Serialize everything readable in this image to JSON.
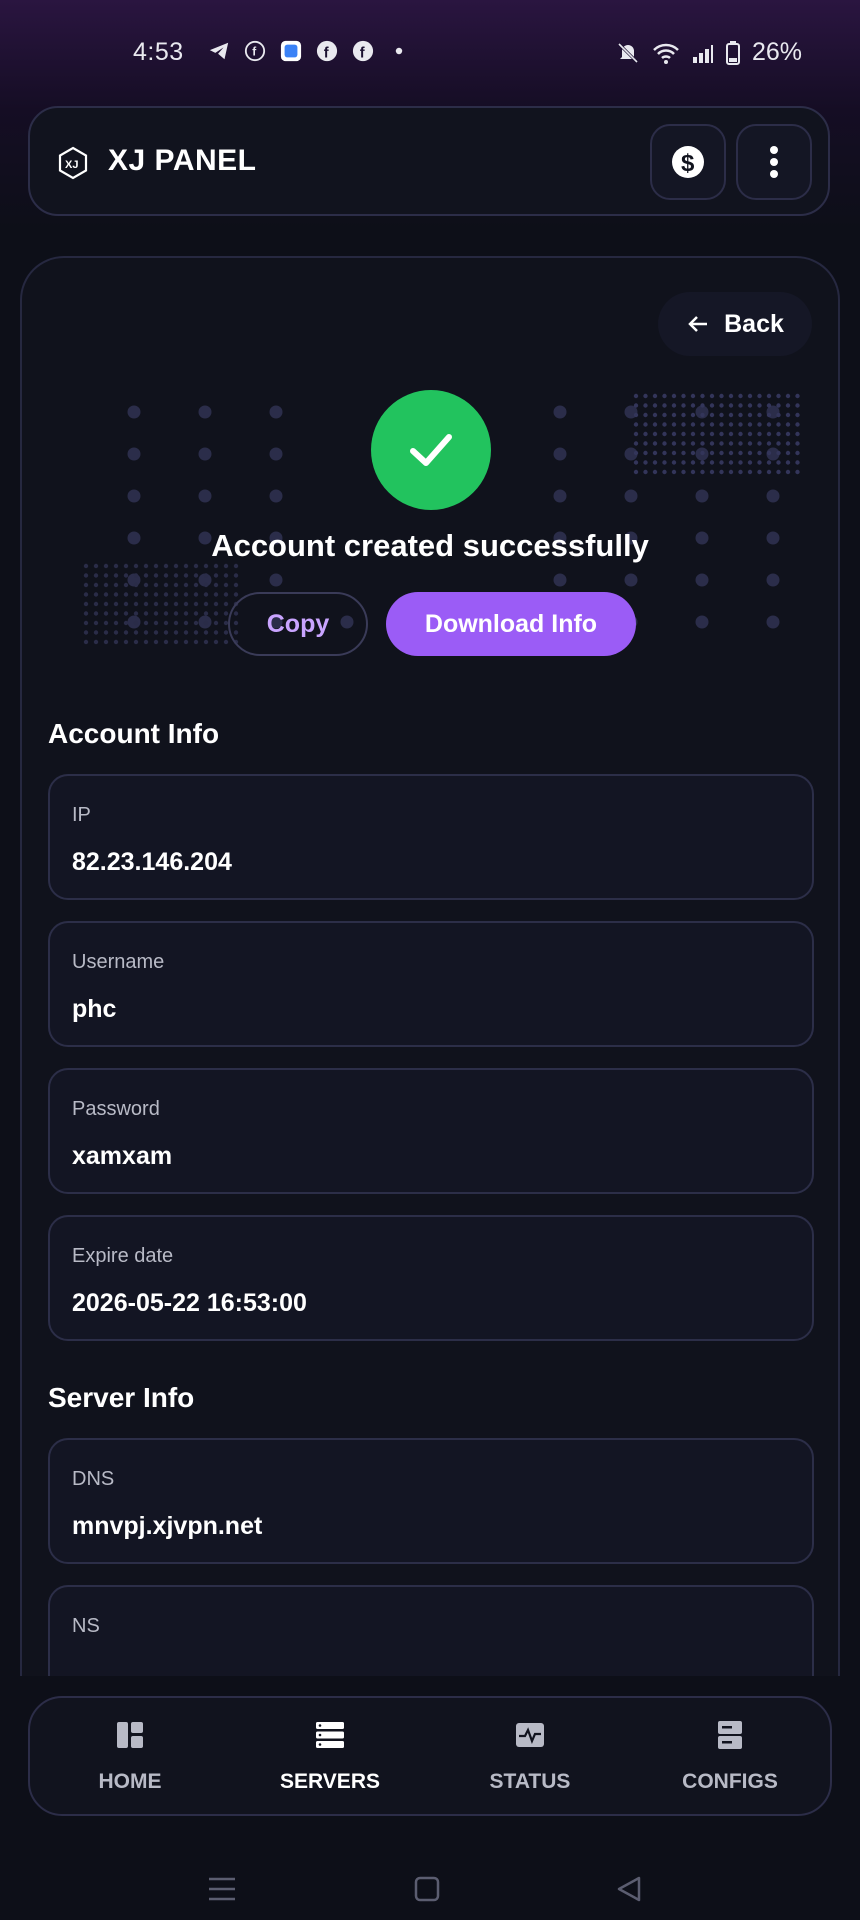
{
  "status_bar": {
    "time": "4:53",
    "battery": "26%"
  },
  "header": {
    "title": "XJ PANEL"
  },
  "card": {
    "back_label": "Back",
    "success_message": "Account created successfully",
    "copy_label": "Copy",
    "download_label": "Download Info"
  },
  "account_info": {
    "title": "Account Info",
    "fields": [
      {
        "label": "IP",
        "value": "82.23.146.204"
      },
      {
        "label": "Username",
        "value": "phc"
      },
      {
        "label": "Password",
        "value": "xamxam"
      },
      {
        "label": "Expire date",
        "value": "2026-05-22 16:53:00"
      }
    ]
  },
  "server_info": {
    "title": "Server Info",
    "fields": [
      {
        "label": "DNS",
        "value": "mnvpj.xjvpn.net"
      },
      {
        "label": "NS",
        "value": ""
      }
    ]
  },
  "nav": {
    "items": [
      {
        "label": "HOME",
        "icon": "layout-icon"
      },
      {
        "label": "SERVERS",
        "icon": "server-list-icon"
      },
      {
        "label": "STATUS",
        "icon": "pulse-icon"
      },
      {
        "label": "CONFIGS",
        "icon": "config-icon"
      }
    ],
    "active": "SERVERS"
  },
  "colors": {
    "accent": "#9b5cf6",
    "success": "#22c35e",
    "background": "#0d0f18"
  }
}
